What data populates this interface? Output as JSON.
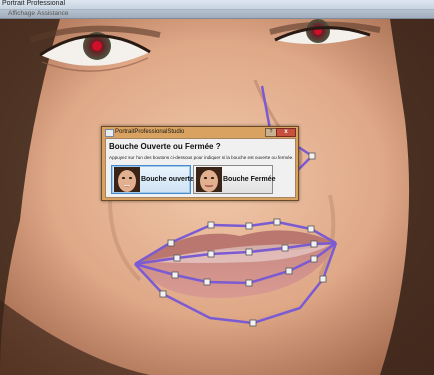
{
  "app": {
    "title": "Portrait Professional"
  },
  "menu": {
    "items": [
      "Affichage",
      "Assistance"
    ]
  },
  "dialog": {
    "title": "PortraitProfessionalStudio",
    "help_label": "?",
    "close_label": "x",
    "heading": "Bouche Ouverte ou Fermée ?",
    "instruction": "Appuyez sur l'un des boutons ci-dessous pour indiquer si la bouche est ouverte ou fermée.",
    "buttons": [
      {
        "label": "Bouche ouverte",
        "icon": "face-thumbnail-icon",
        "selected": true
      },
      {
        "label": "Bouche Fermée",
        "icon": "face-thumbnail-icon",
        "selected": false
      }
    ]
  },
  "overlay": {
    "outline_color": "#7b5bd2",
    "handle_color": "#f2f2f2"
  }
}
